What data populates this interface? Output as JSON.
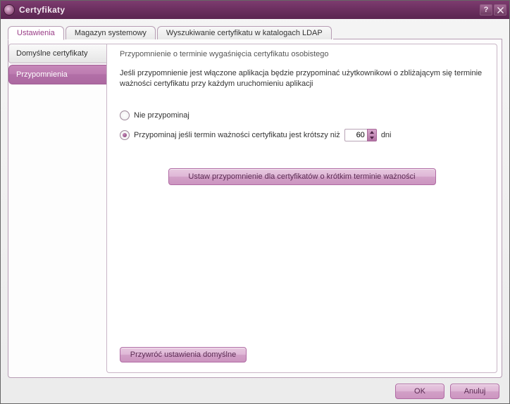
{
  "window": {
    "title": "Certyfikaty"
  },
  "tabs": [
    {
      "label": "Ustawienia",
      "active": true
    },
    {
      "label": "Magazyn systemowy",
      "active": false
    },
    {
      "label": "Wyszukiwanie certyfikatu w katalogach LDAP",
      "active": false
    }
  ],
  "sidebar": {
    "items": [
      {
        "label": "Domyślne certyfikaty",
        "active": false
      },
      {
        "label": "Przypomnienia",
        "active": true
      }
    ]
  },
  "group": {
    "title": "Przypomnienie o terminie wygaśnięcia certyfikatu osobistego",
    "description": "Jeśli przypomnienie jest włączone aplikacja będzie przypominać użytkownikowi o zbliżającym się terminie ważności certyfikatu przy każdym uruchomieniu aplikacji",
    "option_none": "Nie przypominaj",
    "option_days_prefix": "Przypominaj jeśli termin ważności certyfikatu jest krótszy niż",
    "option_days_suffix": "dni",
    "days_value": "60",
    "selected": "days",
    "set_button": "Ustaw przypomnienie dla certyfikatów o krótkim terminie ważności",
    "restore_button": "Przywróć ustawienia domyślne"
  },
  "footer": {
    "ok": "OK",
    "cancel": "Anuluj"
  }
}
